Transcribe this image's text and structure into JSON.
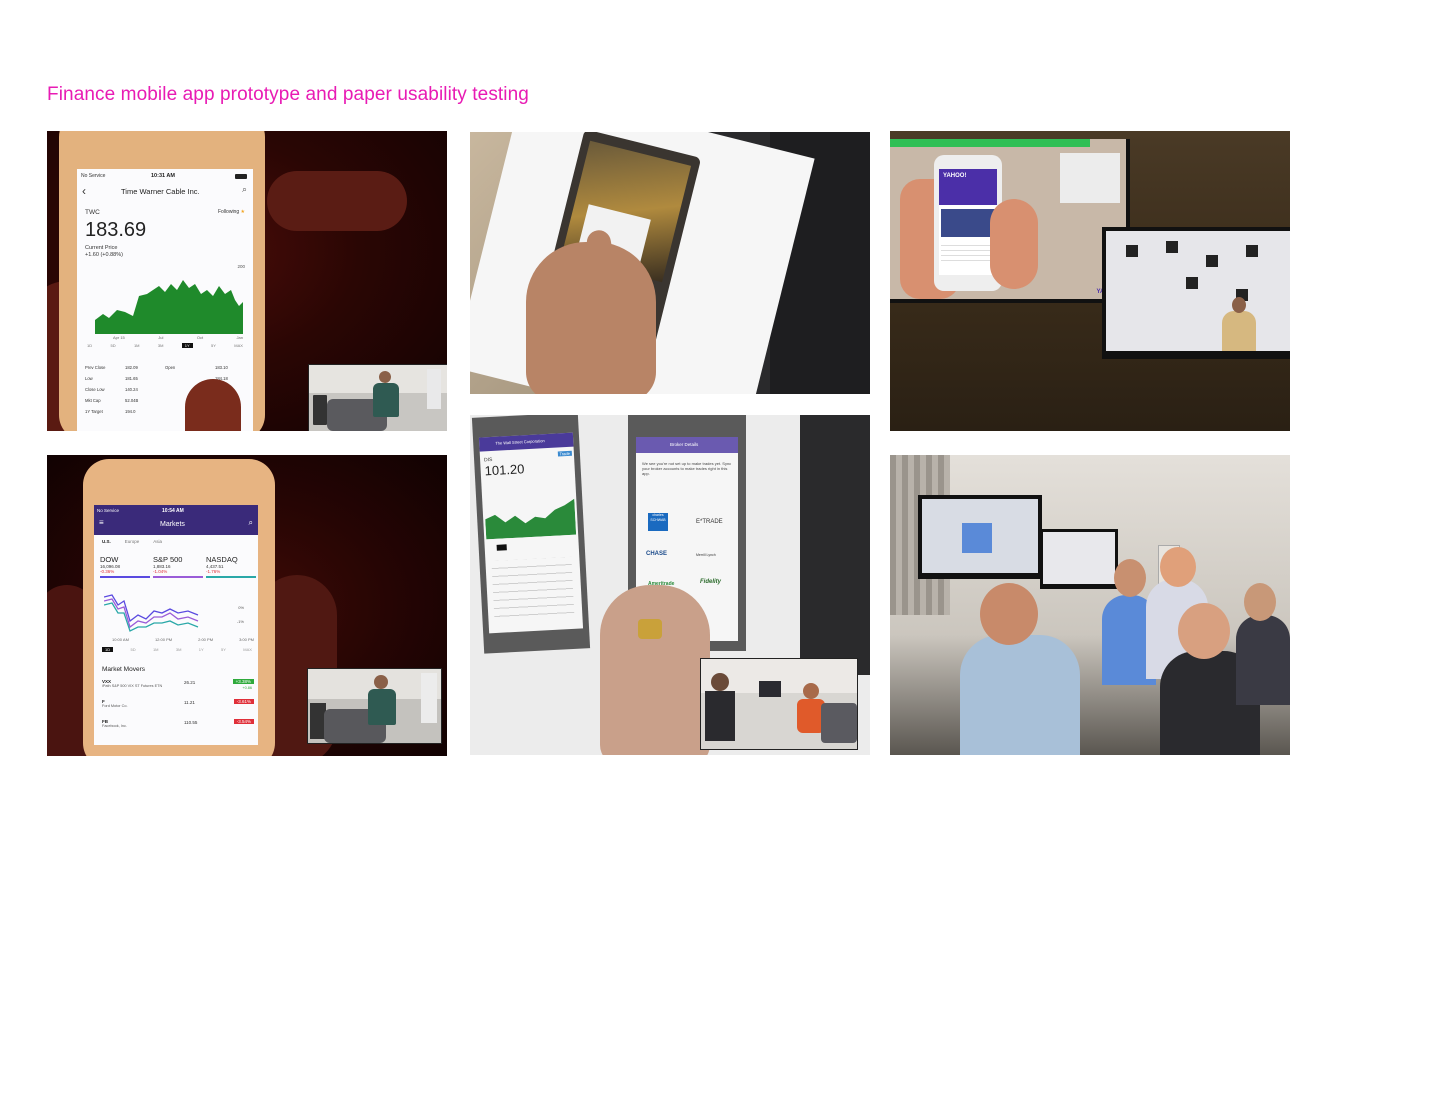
{
  "page": {
    "title": "Finance mobile app prototype and paper usability testing"
  },
  "photos": [
    {
      "id": "twc",
      "status_left": "No Service",
      "time": "10:31 AM",
      "nav_title": "Time Warner Cable Inc.",
      "ticker": "TWC",
      "following": "Following",
      "price": "183.69",
      "price_label": "Current Price",
      "change": "+1.60 (+0.88%)",
      "axis_hi": "200",
      "months": [
        "Apr 15",
        "Jul",
        "Oct",
        "Jan"
      ],
      "ranges": [
        "1D",
        "5D",
        "1M",
        "3M",
        "1Y",
        "5Y",
        "MAX"
      ],
      "stats": [
        {
          "k": "Prev Close",
          "v": "182.09",
          "k2": "Open",
          "v2": "183.10"
        },
        {
          "k": "Low",
          "v": "181.65",
          "k2": "",
          "v2": "184.18"
        },
        {
          "k": "Close Low",
          "v": "140.24",
          "k2": "",
          "v2": "184.22"
        },
        {
          "k": "Mkt Cap",
          "v": "52.04B",
          "k2": "",
          "v2": "72,076"
        },
        {
          "k": "1Y Target",
          "v": "194.0",
          "k2": "",
          "v2": "4.93M"
        }
      ]
    },
    {
      "id": "markets",
      "status_left": "No Service",
      "time": "10:54 AM",
      "nav_title": "Markets",
      "regions": [
        "U.S.",
        "Europe",
        "Asia"
      ],
      "indices": [
        {
          "name": "DOW",
          "value": "16,096.08",
          "change": "-0.36%"
        },
        {
          "name": "S&P 500",
          "value": "1,883.16",
          "change": "-1.04%"
        },
        {
          "name": "NASDAQ",
          "value": "4,437.51",
          "change": "-1.76%"
        }
      ],
      "times": [
        "10:00 AM",
        "12:00 PM",
        "2:00 PM",
        "3:00 PM"
      ],
      "pct": [
        "0%",
        "-1%"
      ],
      "ranges": [
        "1D",
        "5D",
        "1M",
        "3M",
        "1Y",
        "5Y",
        "MAX"
      ],
      "movers_title": "Market Movers",
      "movers": [
        {
          "sym": "VXX",
          "name": "iPath S&P 500 VIX ST Futures ETN",
          "price": "26.21",
          "chg": "+3.38%",
          "chg2": "+0.86"
        },
        {
          "sym": "F",
          "name": "Ford Motor Co.",
          "price": "11.21",
          "chg": "-3.61%",
          "chg2": ""
        },
        {
          "sym": "FB",
          "name": "Facebook, Inc.",
          "price": "110.55",
          "chg": "-3.54%",
          "chg2": ""
        }
      ]
    },
    {
      "id": "paper-dis",
      "nav_title": "The Wall Street Corporation",
      "ticker": "DIS",
      "price": "101.20",
      "trade": "Trade",
      "broker_title": "Broker Details",
      "broker_text": "We see you're not set up to make trades yet. Sync your broker accounts to make trades right in this app.",
      "brokers": [
        "charles SCHWAB",
        "E*TRADE",
        "CHASE",
        "Merrill Lynch",
        "Ameritrade",
        "Fidelity"
      ]
    },
    {
      "id": "remote-monitor",
      "brand": "YAHOO!",
      "brand2": "YAHOO!"
    }
  ],
  "colors": {
    "accent": "#e81bb4",
    "chart_green": "#1f8a2b",
    "down_red": "#e0303a",
    "up_green": "#2faa3c",
    "yahoo_purple": "#4b2fa8"
  }
}
